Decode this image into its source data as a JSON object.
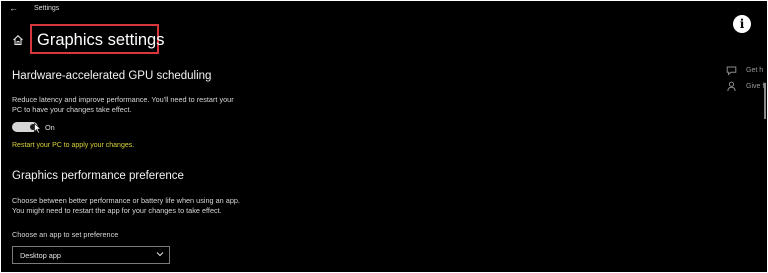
{
  "titlebar": {
    "back_icon": "←",
    "app_title": "Settings"
  },
  "header": {
    "page_title": "Graphics settings",
    "highlight_color": "#d9363e"
  },
  "gpu_scheduling": {
    "heading": "Hardware-accelerated GPU scheduling",
    "description_line1": "Reduce latency and improve performance. You'll need to restart your",
    "description_line2": "PC to have your changes take effect.",
    "toggle_state": "On",
    "toggle_on": true,
    "restart_notice": "Restart your PC to apply your changes.",
    "notice_color": "#d8d23a"
  },
  "performance_preference": {
    "heading": "Graphics performance preference",
    "description_line1": "Choose between better performance or battery life when using an app.",
    "description_line2": "You might need to restart the app for your changes to take effect.",
    "picker_label": "Choose an app to set preference",
    "picker_value": "Desktop app"
  },
  "side_panel": {
    "info_glyph": "i",
    "links": [
      {
        "label": "Get h",
        "icon": "chat-help-icon"
      },
      {
        "label": "Give f",
        "icon": "feedback-person-icon"
      }
    ]
  }
}
